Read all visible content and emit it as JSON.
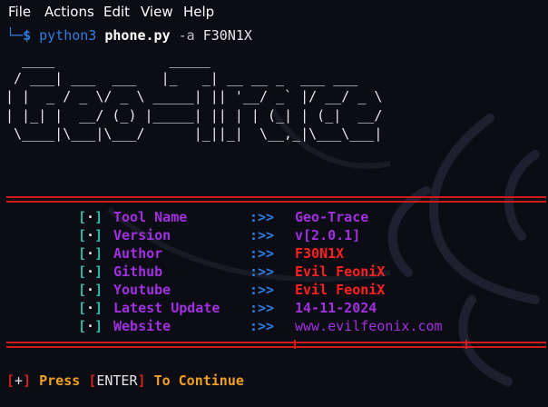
{
  "menubar": {
    "items": [
      "File",
      "Actions",
      "Edit",
      "View",
      "Help"
    ]
  },
  "command": {
    "prompt_branch": "└─",
    "prompt_symbol": "$",
    "program": "python3",
    "script": "phone.py",
    "flag": "-a",
    "argument": "F30N1X"
  },
  "banner": {
    "ascii_art": "  ____              _____\n / ___| ___  ___   |_   _| __ __ _  ___ ___\n| |  _ / _ \\/ _ \\ _____| || '__/ _` |/ __/ _ \\\n| |_| |  __/ (_) |_____| || | | (_| | (_|  __/\n \\____|\\___|\\___/      |_||_|  \\__,_|\\___\\___|"
  },
  "info": [
    {
      "bracket_open": "[",
      "dot": "·",
      "bracket_close": "]",
      "key": "Tool Name",
      "sep": ":>>",
      "value": "Geo-Trace",
      "color": "#a030e0"
    },
    {
      "bracket_open": "[",
      "dot": "·",
      "bracket_close": "]",
      "key": "Version",
      "sep": ":>>",
      "value": "v[2.0.1]",
      "color": "#a030e0"
    },
    {
      "bracket_open": "[",
      "dot": "·",
      "bracket_close": "]",
      "key": "Author",
      "sep": ":>>",
      "value": "F30N1X",
      "color": "#ff2020"
    },
    {
      "bracket_open": "[",
      "dot": "·",
      "bracket_close": "]",
      "key": "Github",
      "sep": ":>>",
      "value": "Evil FeoniX",
      "color": "#ff2020"
    },
    {
      "bracket_open": "[",
      "dot": "·",
      "bracket_close": "]",
      "key": "Youtube",
      "sep": ":>>",
      "value": "Evil FeoniX",
      "color": "#ff2020"
    },
    {
      "bracket_open": "[",
      "dot": "·",
      "bracket_close": "]",
      "key": "Latest Update",
      "sep": ":>>",
      "value": "14-11-2024",
      "color": "#a030e0"
    },
    {
      "bracket_open": "[",
      "dot": "·",
      "bracket_close": "]",
      "key": "Website",
      "sep": ":>>",
      "value": "www.evilfeonix.com",
      "color": "#a030e0"
    }
  ],
  "footer": {
    "open": "[",
    "plus": "+",
    "close": "]",
    "press": "Press",
    "enter_open": "[",
    "enter": "ENTER",
    "enter_close": "]",
    "rest": "To Continue"
  },
  "colors": {
    "background": "#0c0c14",
    "accent_red": "#d11a1a",
    "accent_blue": "#2f7de1",
    "accent_purple": "#a030e0",
    "accent_orange": "#f0a020"
  }
}
